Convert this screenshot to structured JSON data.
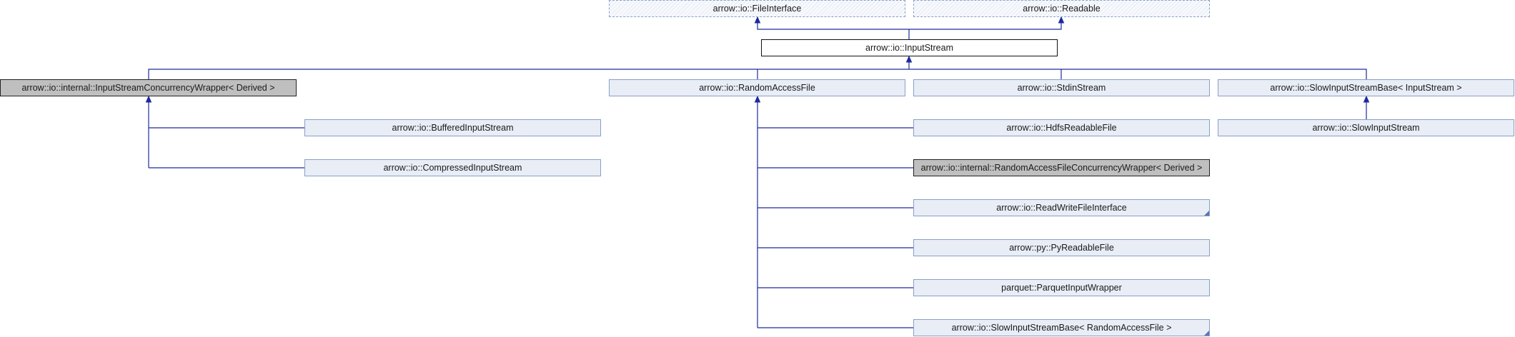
{
  "diagram": {
    "edge_color": "#1d2a9e",
    "nodes": {
      "file_interface": "arrow::io::FileInterface",
      "readable": "arrow::io::Readable",
      "input_stream": "arrow::io::InputStream",
      "input_stream_concurrency_wrapper": "arrow::io::internal::InputStreamConcurrencyWrapper< Derived >",
      "random_access_file": "arrow::io::RandomAccessFile",
      "stdin_stream": "arrow::io::StdinStream",
      "slow_input_stream_base_input": "arrow::io::SlowInputStreamBase< InputStream >",
      "buffered_input_stream": "arrow::io::BufferedInputStream",
      "compressed_input_stream": "arrow::io::CompressedInputStream",
      "hdfs_readable_file": "arrow::io::HdfsReadableFile",
      "slow_input_stream": "arrow::io::SlowInputStream",
      "random_access_file_concurrency_wrapper": "arrow::io::internal::RandomAccessFileConcurrencyWrapper< Derived >",
      "read_write_file_interface": "arrow::io::ReadWriteFileInterface",
      "py_readable_file": "arrow::py::PyReadableFile",
      "parquet_input_wrapper": "parquet::ParquetInputWrapper",
      "slow_input_stream_base_raf": "arrow::io::SlowInputStreamBase< RandomAccessFile >"
    }
  }
}
